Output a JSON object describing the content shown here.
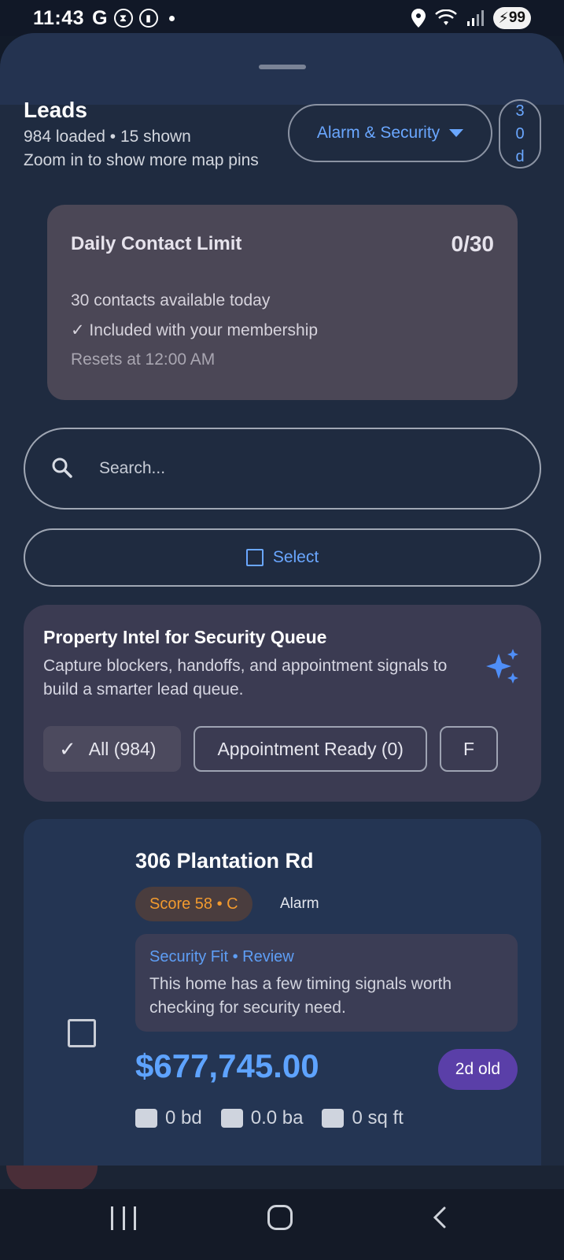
{
  "status_bar": {
    "time": "11:43",
    "g_label": "G",
    "battery": "99"
  },
  "header": {
    "title": "Leads",
    "subtitle_counts": "984 loaded • 15 shown",
    "subtitle_hint": "Zoom in to show more map pins",
    "category_dropdown": "Alarm & Security",
    "period_lines": [
      "3",
      "0",
      "d"
    ]
  },
  "limit_card": {
    "title": "Daily Contact Limit",
    "count": "0/30",
    "available": "30 contacts available today",
    "membership": "✓ Included with your membership",
    "resets": "Resets at 12:00 AM"
  },
  "search": {
    "placeholder": "Search..."
  },
  "select_button": {
    "label": "Select"
  },
  "intel_card": {
    "title": "Property Intel for Security Queue",
    "description": "Capture blockers, handoffs, and appointment signals to build a smarter lead queue.",
    "chips": [
      {
        "label": "All (984)",
        "selected": true
      },
      {
        "label": "Appointment Ready (0)",
        "selected": false
      },
      {
        "label": "F",
        "selected": false
      }
    ]
  },
  "lead": {
    "address": "306 Plantation Rd",
    "score": "Score 58 • C",
    "type": "Alarm",
    "fit_title": "Security Fit • Review",
    "fit_description": "This home has a few timing signals worth checking for security need.",
    "price": "$677,745.00",
    "age": "2d old",
    "beds": "0 bd",
    "baths": "0.0 ba",
    "sqft": "0 sq ft"
  },
  "colors": {
    "accent": "#6aa7ff",
    "score_text": "#f29a2e",
    "age_badge": "#5a3fa8",
    "sheet_bg": "#1f2b40"
  }
}
